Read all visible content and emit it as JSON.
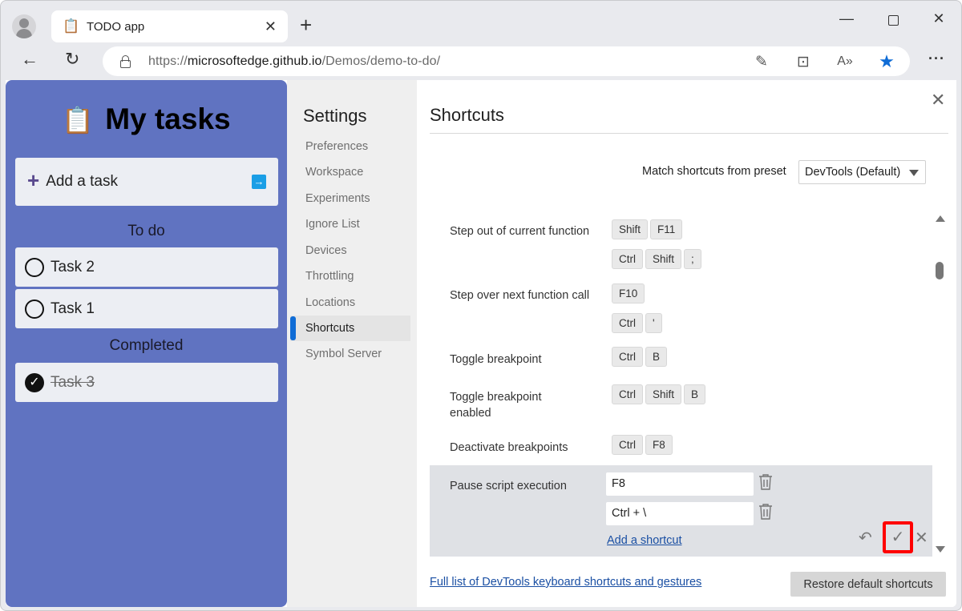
{
  "browser": {
    "tab_title": "TODO app",
    "tab_favicon": "📋",
    "url_scheme": "https://",
    "url_host": "microsoftedge.github.io",
    "url_path": "/Demos/demo-to-do/",
    "new_tab_glyph": "+",
    "tab_close_glyph": "✕",
    "minimize_glyph": "—",
    "close_glyph": "✕",
    "back_glyph": "←",
    "reload_glyph": "↻",
    "more_glyph": "···",
    "omni_icons": [
      {
        "name": "page-edit-icon",
        "glyph": "✎"
      },
      {
        "name": "briefcase-icon",
        "glyph": "⊡"
      },
      {
        "name": "read-aloud-icon",
        "glyph": "A»"
      },
      {
        "name": "favorite-star-icon",
        "glyph": "★"
      }
    ]
  },
  "todo": {
    "title": "My tasks",
    "title_icon": "📋",
    "add_task_label": "Add a task",
    "add_task_plus": "+",
    "add_task_arrow": "➡",
    "todo_header": "To do",
    "completed_header": "Completed",
    "todo_tasks": [
      "Task 2",
      "Task 1"
    ],
    "completed_tasks": [
      "Task 3"
    ],
    "check_glyph": "✓",
    "accent_color": "#6073c1"
  },
  "settings": {
    "title": "Settings",
    "nav": [
      "Preferences",
      "Workspace",
      "Experiments",
      "Ignore List",
      "Devices",
      "Throttling",
      "Locations",
      "Shortcuts",
      "Symbol Server"
    ],
    "active": "Shortcuts"
  },
  "shortcuts": {
    "title": "Shortcuts",
    "close_glyph": "✕",
    "preset_label": "Match shortcuts from preset",
    "preset_value": "DevTools (Default)",
    "items": [
      {
        "label": "Step out of current function",
        "bindings": [
          [
            "Shift",
            "F11"
          ],
          [
            "Ctrl",
            "Shift",
            ";"
          ]
        ]
      },
      {
        "label": "Step over next function call",
        "bindings": [
          [
            "F10"
          ],
          [
            "Ctrl",
            "'"
          ]
        ]
      },
      {
        "label": "Toggle breakpoint",
        "bindings": [
          [
            "Ctrl",
            "B"
          ]
        ]
      },
      {
        "label": "Toggle breakpoint enabled",
        "bindings": [
          [
            "Ctrl",
            "Shift",
            "B"
          ]
        ]
      },
      {
        "label": "Deactivate breakpoints",
        "bindings": [
          [
            "Ctrl",
            "F8"
          ]
        ]
      }
    ],
    "editing": {
      "label": "Pause script execution",
      "inputs": [
        "F8",
        "Ctrl + \\"
      ],
      "add_link": "Add a shortcut",
      "undo_glyph": "↶",
      "confirm_glyph": "✓",
      "cancel_glyph": "✕"
    },
    "full_list_link": "Full list of DevTools keyboard shortcuts and gestures",
    "restore_button": "Restore default shortcuts"
  }
}
